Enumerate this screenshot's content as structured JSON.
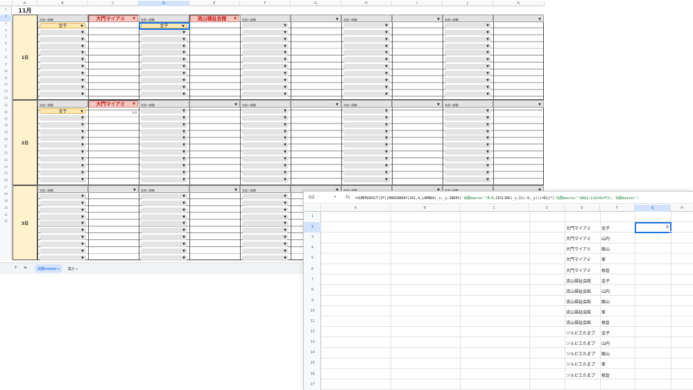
{
  "back_sheet": {
    "columns": [
      "A",
      "B",
      "C",
      "D",
      "E",
      "F",
      "G",
      "H",
      "I",
      "J",
      "K"
    ],
    "selected_column": "D",
    "month": "11月",
    "day_labels": [
      "1日",
      "2日",
      "3日"
    ],
    "row_numbers": [
      "1",
      "2",
      "3",
      "4",
      "5",
      "6",
      "7",
      "8",
      "9",
      "10",
      "11",
      "12",
      "13",
      "14",
      "15",
      "16",
      "17",
      "18",
      "19",
      "20",
      "21",
      "22",
      "23",
      "24",
      "25",
      "26",
      "27",
      "28",
      "29",
      "30",
      "31",
      "32"
    ],
    "header_label": "名前へ移動",
    "venues": [
      "大門マイアミ",
      "流山福祉会館"
    ],
    "selected_name": "金子",
    "zero_value": "0.0",
    "tabs": {
      "add": "+",
      "menu": "≡",
      "sheets": [
        "出勤master",
        "集計"
      ]
    }
  },
  "front_sheet": {
    "name_box": "G2",
    "fx": "fx",
    "formula_prefix": "=SUMPRODUCT(IF((MAKEARRAY(341,9,LAMBDA(_x,_y,INDEX(",
    "formula_str1": "'出勤master'!B:K",
    "formula_mid": ",CEILING(_x,11)-9,_y)))=E2)*(",
    "formula_str2": "'出勤master'!$B$2:$J$342=F2),",
    "formula_str3": "'出勤master'!",
    "columns": [
      "A",
      "B",
      "C",
      "D",
      "E",
      "F",
      "G",
      "H"
    ],
    "selected_column": "G",
    "row_numbers": [
      "1",
      "2",
      "3",
      "4",
      "5",
      "6",
      "7",
      "8",
      "9",
      "10",
      "11",
      "12",
      "13",
      "14",
      "15",
      "16",
      "17"
    ],
    "selected_row": "2",
    "selected_value": "0",
    "rows": [
      {
        "venue": "大門マイアミ",
        "name": "金子"
      },
      {
        "venue": "大門マイアミ",
        "name": "山内"
      },
      {
        "venue": "大門マイアミ",
        "name": "飯山"
      },
      {
        "venue": "大門マイアミ",
        "name": "峯"
      },
      {
        "venue": "大門マイアミ",
        "name": "根倉"
      },
      {
        "venue": "流山福祉会館",
        "name": "金子"
      },
      {
        "venue": "流山福祉会館",
        "name": "山内"
      },
      {
        "venue": "流山福祉会館",
        "name": "飯山"
      },
      {
        "venue": "流山福祉会館",
        "name": "峯"
      },
      {
        "venue": "流山福祉会館",
        "name": "根倉"
      },
      {
        "venue": "ソルビエたまプ",
        "name": "金子"
      },
      {
        "venue": "ソルビエたまプ",
        "name": "山内"
      },
      {
        "venue": "ソルビエたまプ",
        "name": "飯山"
      },
      {
        "venue": "ソルビエたまプ",
        "name": "峯"
      },
      {
        "venue": "ソルビエたまプ",
        "name": "根倉"
      }
    ]
  }
}
